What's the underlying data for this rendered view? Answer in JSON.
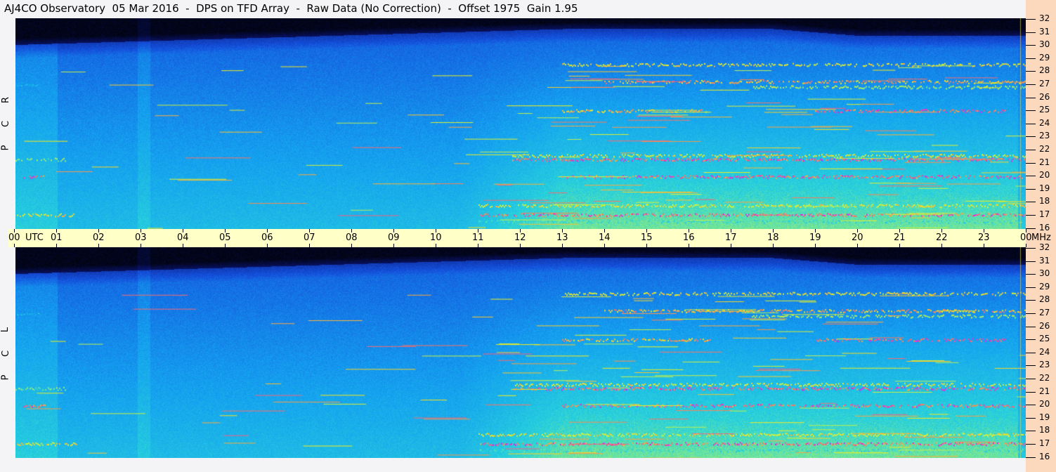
{
  "title": "AJ4CO Observatory  05 Mar 2016  -  DPS on TFD Array  -  Raw Data (No Correction)  -  Offset 1975  Gain 1.95",
  "chart_data": {
    "type": "heatmap",
    "title": "AJ4CO Observatory  05 Mar 2016  -  DPS on TFD Array  -  Raw Data (No Correction)  -  Offset 1975  Gain 1.95",
    "xlabel": "UTC",
    "ylabel": "MHz",
    "x_range_hours": [
      0,
      24
    ],
    "y_range_mhz": [
      16,
      32
    ],
    "time_ticks": [
      "00",
      "01",
      "02",
      "03",
      "04",
      "05",
      "06",
      "07",
      "08",
      "09",
      "10",
      "11",
      "12",
      "13",
      "14",
      "15",
      "16",
      "17",
      "18",
      "19",
      "20",
      "21",
      "22",
      "23",
      "00"
    ],
    "freq_ticks": [
      "32",
      "31",
      "30",
      "29",
      "28",
      "27",
      "26",
      "25",
      "24",
      "23",
      "22",
      "21",
      "20",
      "19",
      "18",
      "17",
      "16"
    ],
    "utc_label": "UTC",
    "mhz_label": "MHz",
    "panels": [
      {
        "name": "RCP",
        "letters": [
          "R",
          "C",
          "P"
        ]
      },
      {
        "name": "LCP",
        "letters": [
          "L",
          "C",
          "P"
        ]
      }
    ],
    "interference_bands": [
      {
        "mhz": 28.5,
        "start": 13,
        "end": 24,
        "level": 0.85
      },
      {
        "mhz": 27.2,
        "start": 14,
        "end": 24,
        "level": 0.9
      },
      {
        "mhz": 26.8,
        "start": 17.5,
        "end": 24,
        "level": 0.8
      },
      {
        "mhz": 27.0,
        "start": 0,
        "end": 0.6,
        "level": 0.6
      },
      {
        "mhz": 25.0,
        "start": 13,
        "end": 16.5,
        "level": 0.9
      },
      {
        "mhz": 25.0,
        "start": 19,
        "end": 23.5,
        "level": 0.95
      },
      {
        "mhz": 21.6,
        "start": 11.8,
        "end": 24,
        "level": 0.85
      },
      {
        "mhz": 21.3,
        "start": 11.8,
        "end": 24,
        "level": 0.95
      },
      {
        "mhz": 21.3,
        "start": 0,
        "end": 1.2,
        "level": 0.75
      },
      {
        "mhz": 20.0,
        "start": 13,
        "end": 24,
        "level": 0.95
      },
      {
        "mhz": 20.0,
        "start": 0.2,
        "end": 0.7,
        "level": 0.95
      },
      {
        "mhz": 17.8,
        "start": 11,
        "end": 24,
        "level": 0.85
      },
      {
        "mhz": 17.1,
        "start": 0,
        "end": 1.5,
        "level": 0.85
      },
      {
        "mhz": 17.1,
        "start": 11,
        "end": 24,
        "level": 0.95
      },
      {
        "mhz": 16.6,
        "start": 11,
        "end": 24,
        "level": 0.7
      }
    ],
    "colors": {
      "timebar": "#ffffc8",
      "freqbar": "#fcd9bd"
    }
  }
}
